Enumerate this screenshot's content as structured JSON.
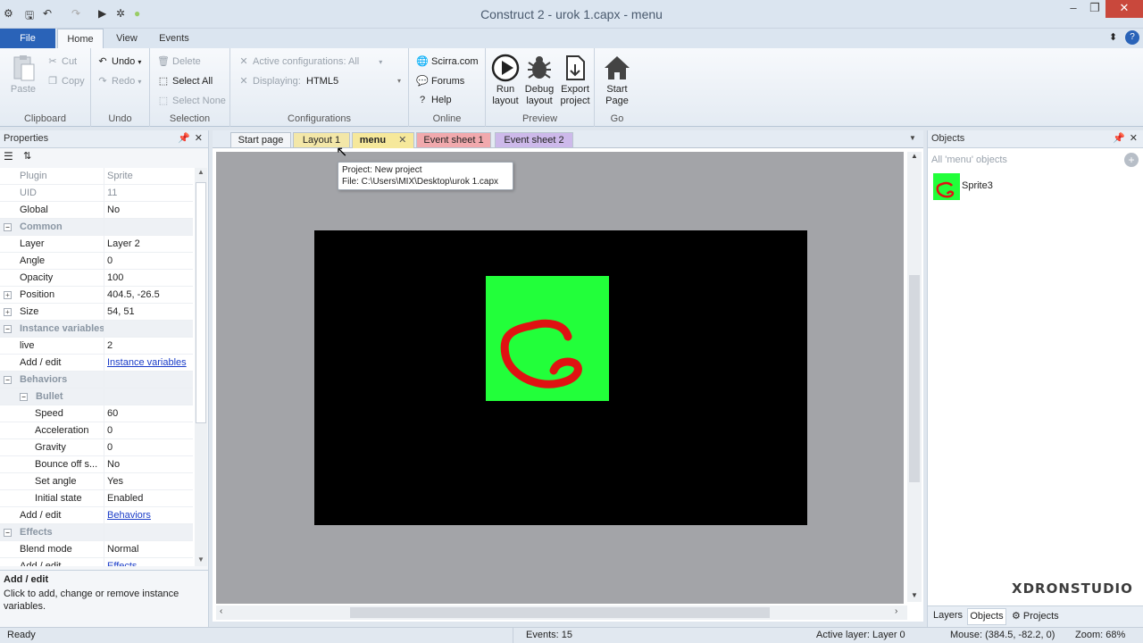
{
  "window": {
    "title": "Construct 2 - urok 1.capx - menu"
  },
  "ribbon": {
    "tabs": [
      "File",
      "Home",
      "View",
      "Events"
    ],
    "clipboard": {
      "label": "Clipboard",
      "paste": "Paste",
      "cut": "Cut",
      "copy": "Copy"
    },
    "undo": {
      "label": "Undo",
      "undo": "Undo",
      "redo": "Redo"
    },
    "selection": {
      "label": "Selection",
      "delete": "Delete",
      "select_all": "Select All",
      "select_none": "Select None"
    },
    "configurations": {
      "label": "Configurations",
      "active": "Active configurations: All",
      "displaying": "Displaying:",
      "displaying_value": "HTML5"
    },
    "online": {
      "label": "Online",
      "scirra": "Scirra.com",
      "forums": "Forums",
      "help": "Help"
    },
    "preview": {
      "label": "Preview",
      "run": "Run",
      "run2": "layout",
      "debug": "Debug",
      "debug2": "layout",
      "export": "Export",
      "export2": "project"
    },
    "go": {
      "label": "Go",
      "start": "Start",
      "start2": "Page"
    }
  },
  "properties": {
    "title": "Properties",
    "rows": [
      {
        "k": "Plugin",
        "v": "Sprite",
        "dim": true
      },
      {
        "k": "UID",
        "v": "11",
        "dim": true
      },
      {
        "k": "Global",
        "v": "No"
      },
      {
        "cat": "Common"
      },
      {
        "k": "Layer",
        "v": "Layer 2"
      },
      {
        "k": "Angle",
        "v": "0"
      },
      {
        "k": "Opacity",
        "v": "100"
      },
      {
        "k": "Position",
        "v": "404.5, -26.5",
        "exp": true
      },
      {
        "k": "Size",
        "v": "54, 51",
        "exp": true
      },
      {
        "cat": "Instance variables"
      },
      {
        "k": "live",
        "v": "2"
      },
      {
        "k": "Add / edit",
        "link": "Instance variables"
      },
      {
        "cat": "Behaviors"
      },
      {
        "cat": "Bullet",
        "sub": true
      },
      {
        "k": "Speed",
        "v": "60",
        "indent": true
      },
      {
        "k": "Acceleration",
        "v": "0",
        "indent": true
      },
      {
        "k": "Gravity",
        "v": "0",
        "indent": true
      },
      {
        "k": "Bounce off s...",
        "v": "No",
        "indent": true
      },
      {
        "k": "Set angle",
        "v": "Yes",
        "indent": true
      },
      {
        "k": "Initial state",
        "v": "Enabled",
        "indent": true
      },
      {
        "k": "Add / edit",
        "link": "Behaviors"
      },
      {
        "cat": "Effects"
      },
      {
        "k": "Blend mode",
        "v": "Normal"
      },
      {
        "k": "Add / edit",
        "link": "Effects"
      }
    ],
    "help_title": "Add / edit",
    "help_text": "Click to add, change or remove instance variables."
  },
  "doc_tabs": [
    "Start page",
    "Layout 1",
    "menu",
    "Event sheet 1",
    "Event sheet 2"
  ],
  "tooltip": {
    "line1": "Project: New project",
    "line2": "File: C:\\Users\\MIX\\Desktop\\urok 1.capx"
  },
  "objects": {
    "title": "Objects",
    "filter": "All 'menu' objects",
    "items": [
      "Sprite3"
    ],
    "bottom_tabs": [
      "Layers",
      "Objects",
      "Projects"
    ]
  },
  "watermark": "XDRONSTUDIO",
  "status": {
    "ready": "Ready",
    "events": "Events: 15",
    "active_layer": "Active layer: Layer 0",
    "mouse": "Mouse: (384.5, -82.2, 0)",
    "zoom": "Zoom: 68%"
  },
  "colors": {
    "accent": "#2a63b8",
    "sprite": "#22ff3a",
    "scribble": "#e01212"
  }
}
